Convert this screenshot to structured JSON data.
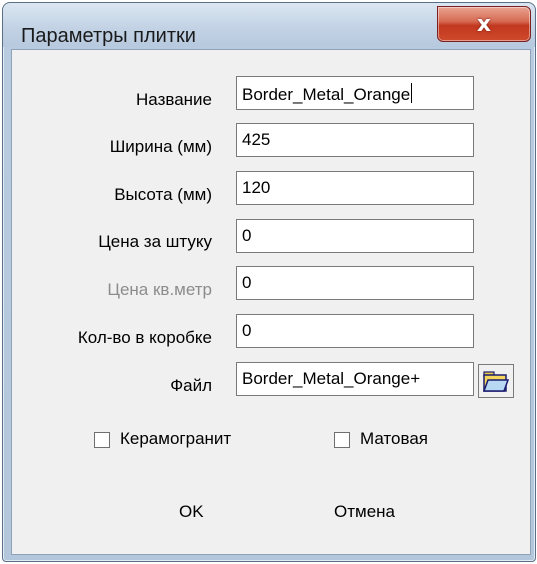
{
  "window": {
    "title": "Параметры плитки",
    "close_glyph": "x"
  },
  "fields": [
    {
      "label": "Название",
      "value": "Border_Metal_Orange",
      "disabled": false
    },
    {
      "label": "Ширина (мм)",
      "value": "425",
      "disabled": false
    },
    {
      "label": "Высота (мм)",
      "value": "120",
      "disabled": false
    },
    {
      "label": "Цена за штуку",
      "value": "0",
      "disabled": false
    },
    {
      "label": "Цена кв.метр",
      "value": "0",
      "disabled": true
    },
    {
      "label": "Кол-во в коробке",
      "value": "0",
      "disabled": false
    },
    {
      "label": "Файл",
      "value": "Border_Metal_Orange+",
      "disabled": false
    }
  ],
  "browse_icon": "open-folder-icon",
  "checkboxes": [
    {
      "label": "Керамогранит",
      "checked": false
    },
    {
      "label": "Матовая",
      "checked": false
    }
  ],
  "buttons": {
    "ok": "OK",
    "cancel": "Отмена"
  },
  "colors": {
    "title_bar": "#c3d3e5",
    "close_button": "#c1381f",
    "dialog_body": "#f0f0f0",
    "disabled_text": "#8c8c8c"
  }
}
